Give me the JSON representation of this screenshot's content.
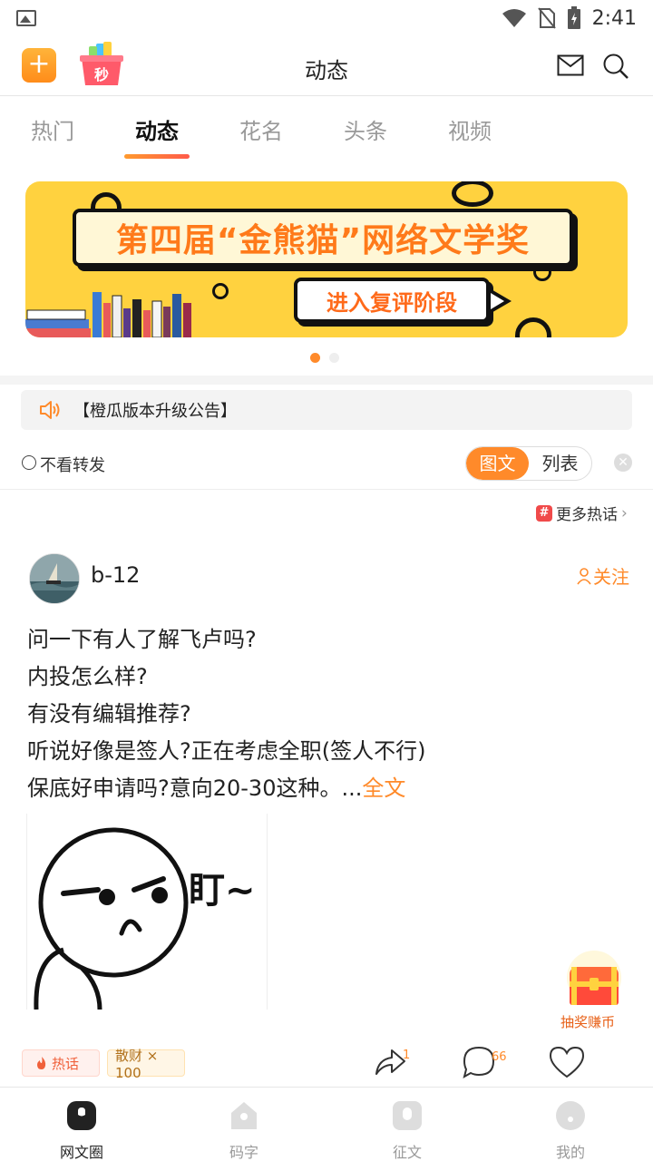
{
  "status_bar": {
    "time": "2:41"
  },
  "header": {
    "title": "动态",
    "plus_label": "+",
    "seckill_label": "秒"
  },
  "tabs": [
    {
      "label": "热门"
    },
    {
      "label": "动态"
    },
    {
      "label": "花名"
    },
    {
      "label": "头条"
    },
    {
      "label": "视频"
    }
  ],
  "banner": {
    "title": "第四届“金熊猫”网络文学奖",
    "subtitle": "进入复评阶段"
  },
  "notice": {
    "text": "【橙瓜版本升级公告】"
  },
  "filter": {
    "checkbox_label": "不看转发",
    "segment": [
      "图文",
      "列表"
    ],
    "selected": "图文"
  },
  "more_hot": {
    "label": "更多热话"
  },
  "post": {
    "username": "b-12",
    "follow_label": "关注",
    "lines": [
      "问一下有人了解飞卢吗?",
      "内投怎么样?",
      "有没有编辑推荐?",
      "听说好像是签人?正在考虑全职(签人不行)",
      "保底好申请吗?意向20-30这种。..."
    ],
    "more_label": "全文",
    "image_text": "盯~",
    "tags": {
      "hot": "热话",
      "coin": "散财 × 100"
    },
    "share_count": "1",
    "comment_count": "66"
  },
  "lottery": {
    "label": "抽奖赚币"
  },
  "bottom_nav": [
    {
      "label": "网文圈"
    },
    {
      "label": "码字"
    },
    {
      "label": "征文"
    },
    {
      "label": "我的"
    }
  ],
  "colors": {
    "accent": "#ff8a2a",
    "banner_bg": "#ffd23f"
  }
}
